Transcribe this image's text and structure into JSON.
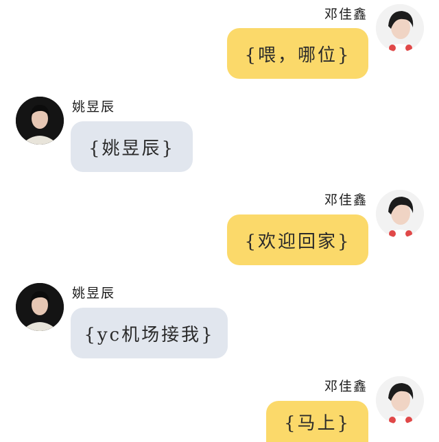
{
  "colors": {
    "self_bubble": "#fbd96a",
    "other_bubble": "#e1e6ee",
    "background": "#ffffff"
  },
  "messages": [
    {
      "side": "right",
      "sender": "邓佳鑫",
      "text": "{喂，哪位}",
      "avatar_icon": "avatar-portrait-icon"
    },
    {
      "side": "left",
      "sender": "姚昱辰",
      "text": "{姚昱辰}",
      "avatar_icon": "avatar-portrait-icon"
    },
    {
      "side": "right",
      "sender": "邓佳鑫",
      "text": "{欢迎回家}",
      "avatar_icon": "avatar-portrait-icon"
    },
    {
      "side": "left",
      "sender": "姚昱辰",
      "text": "{yc机场接我}",
      "avatar_icon": "avatar-portrait-icon"
    },
    {
      "side": "right",
      "sender": "邓佳鑫",
      "text": "{马上}",
      "avatar_icon": "avatar-portrait-icon"
    }
  ]
}
